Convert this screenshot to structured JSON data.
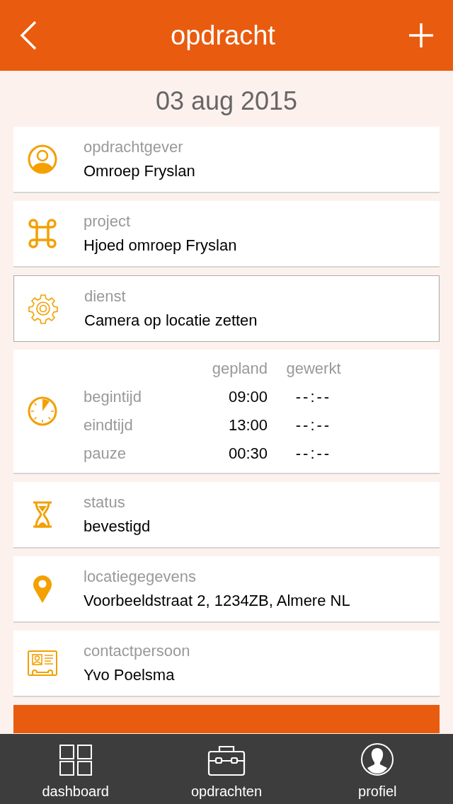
{
  "header": {
    "title": "opdracht"
  },
  "date": "03 aug 2015",
  "cards": [
    {
      "kind": "client",
      "label": "opdrachtgever",
      "value": "Omroep Fryslan",
      "selected": false
    },
    {
      "kind": "project",
      "label": "project",
      "value": "Hjoed omroep Fryslan",
      "selected": false
    },
    {
      "kind": "service",
      "label": "dienst",
      "value": "Camera op locatie zetten",
      "selected": true
    },
    {
      "kind": "times",
      "columns": [
        "gepland",
        "gewerkt"
      ],
      "rows": [
        {
          "label": "begintijd",
          "planned": "09:00",
          "worked": "--:--"
        },
        {
          "label": "eindtijd",
          "planned": "13:00",
          "worked": "--:--"
        },
        {
          "label": "pauze",
          "planned": "00:30",
          "worked": "--:--"
        }
      ],
      "selected": false
    },
    {
      "kind": "status",
      "label": "status",
      "value": "bevestigd",
      "selected": false
    },
    {
      "kind": "location",
      "label": "locatiegegevens",
      "value": "Voorbeeldstraat 2, 1234ZB, Almere NL",
      "selected": false
    },
    {
      "kind": "contact",
      "label": "contactpersoon",
      "value": "Yvo Poelsma",
      "selected": false
    }
  ],
  "tabs": [
    {
      "kind": "dashboard",
      "label": "dashboard"
    },
    {
      "kind": "assignments",
      "label": "opdrachten"
    },
    {
      "kind": "profile",
      "label": "profiel"
    }
  ]
}
